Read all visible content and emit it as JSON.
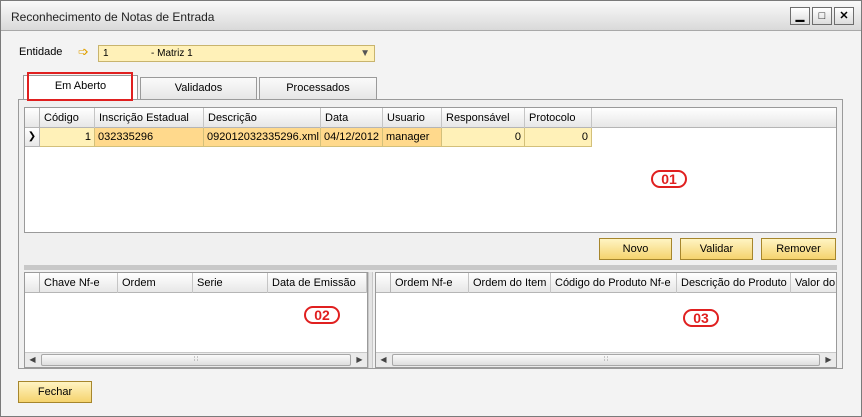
{
  "window": {
    "title": "Reconhecimento de Notas de Entrada",
    "controls": {
      "minimize": "▁",
      "maximize": "□",
      "close": "✕"
    }
  },
  "entity": {
    "label": "Entidade",
    "code": "1",
    "name": "- Matriz 1"
  },
  "tabs": [
    {
      "label": "Em Aberto"
    },
    {
      "label": "Validados"
    },
    {
      "label": "Processados"
    }
  ],
  "main_grid": {
    "columns": [
      "Código",
      "Inscrição Estadual",
      "Descrição",
      "Data",
      "Usuario",
      "Responsável",
      "Protocolo"
    ],
    "rows": [
      [
        "1",
        "032335296",
        "092012032335296.xml",
        "04/12/2012",
        "manager",
        "0",
        "0"
      ]
    ]
  },
  "buttons": {
    "novo": "Novo",
    "validar": "Validar",
    "remover": "Remover",
    "fechar": "Fechar"
  },
  "left_grid": {
    "columns": [
      "Chave Nf-e",
      "Ordem",
      "Serie",
      "Data de Emissão"
    ]
  },
  "right_grid": {
    "columns": [
      "Ordem Nf-e",
      "Ordem do Item",
      "Código do Produto Nf-e",
      "Descrição do Produto",
      "Valor do"
    ]
  },
  "annotations": [
    "01",
    "02",
    "03"
  ],
  "colors": {
    "highlight": "#e02020",
    "field_yellow": "#fff1b8",
    "button_gold": "#f5d36e"
  }
}
